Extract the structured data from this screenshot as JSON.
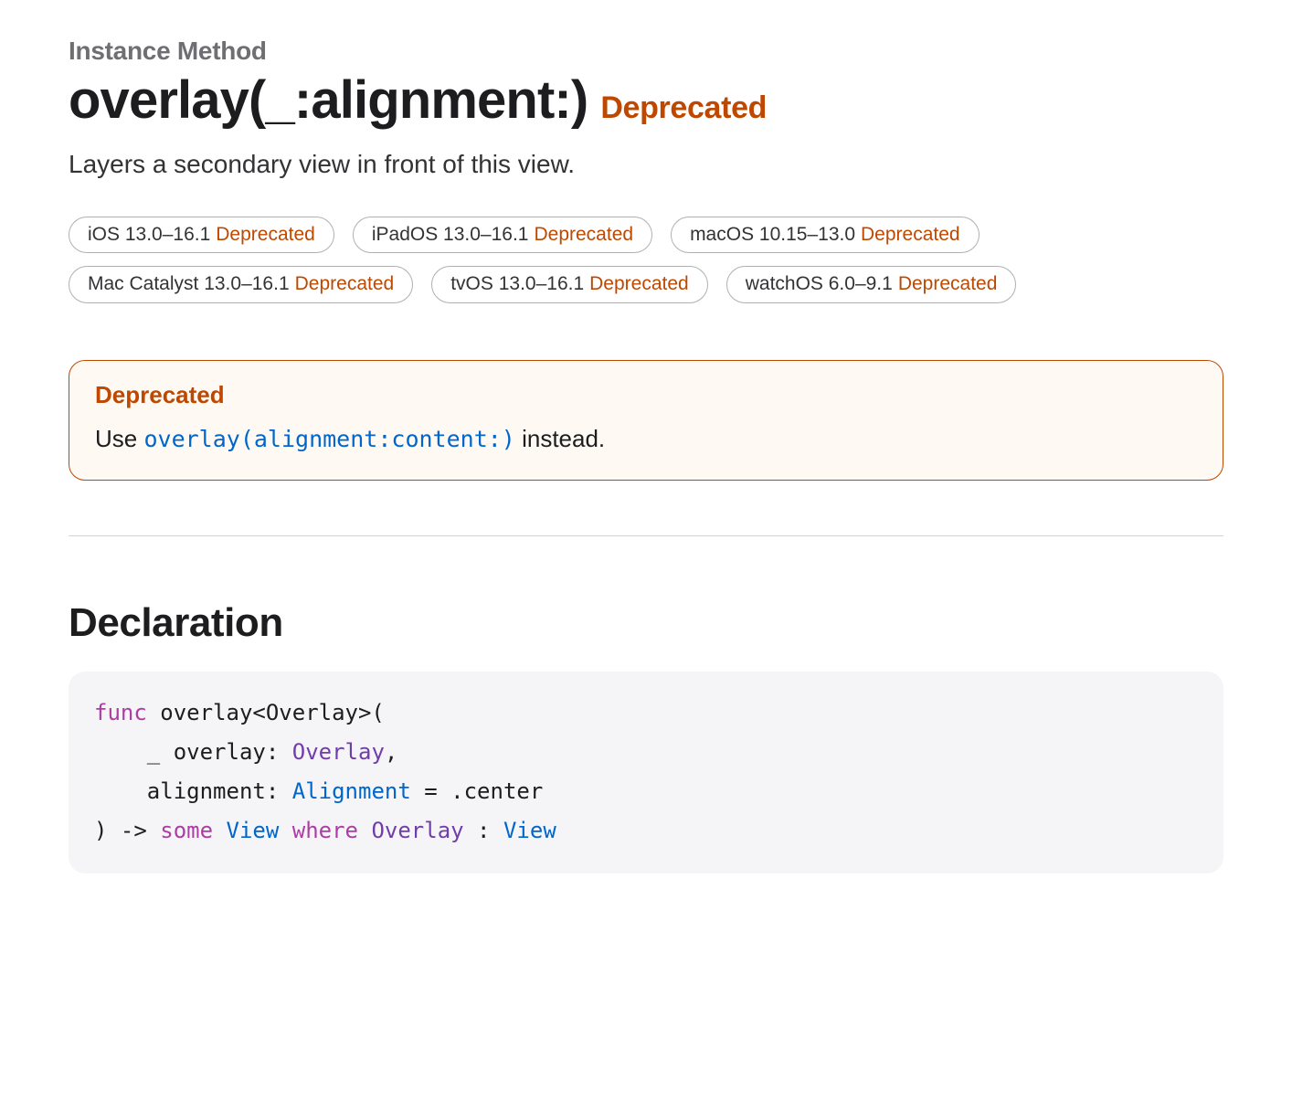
{
  "eyebrow": "Instance Method",
  "title": "overlay(_:alignment:)",
  "title_badge": "Deprecated",
  "summary": "Layers a secondary view in front of this view.",
  "platforms": [
    {
      "label": "iOS 13.0–16.1",
      "status": "Deprecated"
    },
    {
      "label": "iPadOS 13.0–16.1",
      "status": "Deprecated"
    },
    {
      "label": "macOS 10.15–13.0",
      "status": "Deprecated"
    },
    {
      "label": "Mac Catalyst 13.0–16.1",
      "status": "Deprecated"
    },
    {
      "label": "tvOS 13.0–16.1",
      "status": "Deprecated"
    },
    {
      "label": "watchOS 6.0–9.1",
      "status": "Deprecated"
    }
  ],
  "aside": {
    "title": "Deprecated",
    "prefix": "Use ",
    "link": "overlay(alignment:content:)",
    "suffix": " instead."
  },
  "declaration": {
    "heading": "Declaration",
    "tokens": {
      "kw_func": "func",
      "name": " overlay<Overlay>(",
      "line2_lead": "    _ overlay: ",
      "type_overlay": "Overlay",
      "comma": ",",
      "line3_lead": "    alignment: ",
      "type_alignment": "Alignment",
      "line3_tail": " = .center",
      "line4_lead": ") -> ",
      "kw_some": "some",
      "sp1": " ",
      "type_view1": "View",
      "sp2": " ",
      "kw_where": "where",
      "sp3": " ",
      "type_overlay2": "Overlay",
      "colon": " : ",
      "type_view2": "View"
    }
  }
}
